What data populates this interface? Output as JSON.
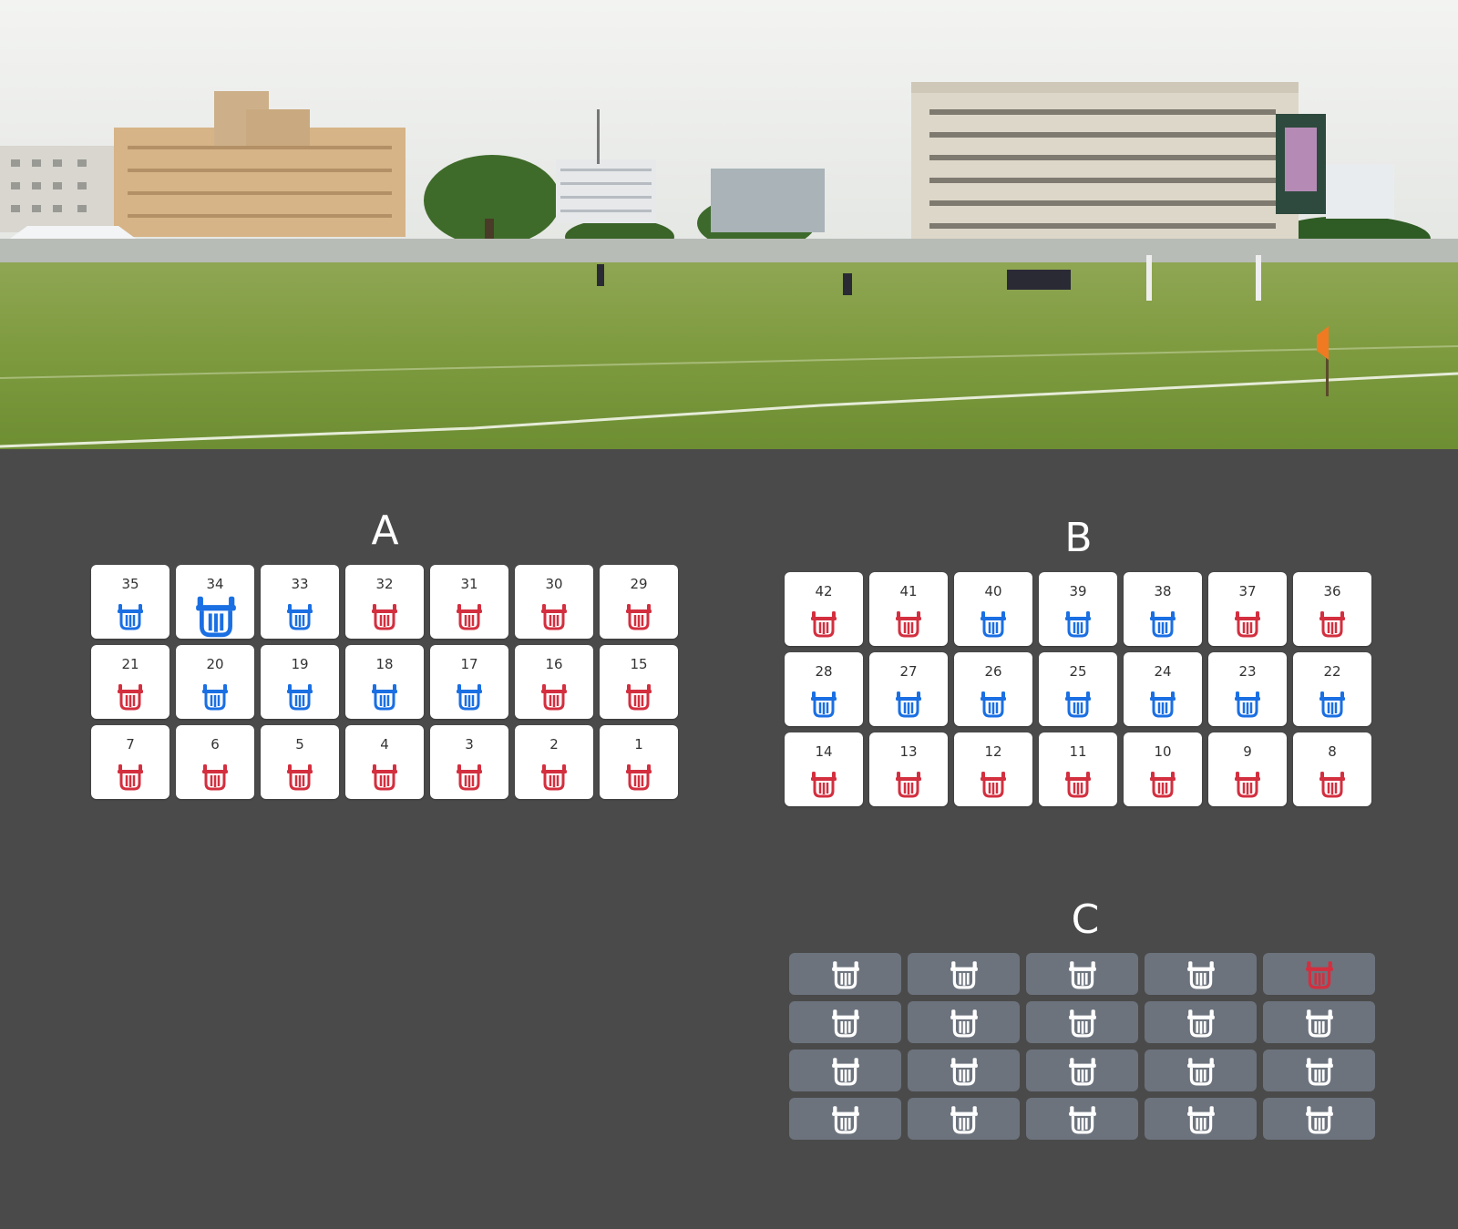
{
  "colors": {
    "available": "#d32f3f",
    "taken": "#1a6fe3",
    "standing_icon": "#ffffff",
    "standing_tile": "#6c737d",
    "background": "#4a4a4a"
  },
  "hero_image": {
    "icon": "stadium-photo"
  },
  "sections": [
    {
      "label": "A",
      "rows": [
        [
          {
            "number": "35",
            "status": "taken"
          },
          {
            "number": "34",
            "status": "taken",
            "selected": true
          },
          {
            "number": "33",
            "status": "taken"
          },
          {
            "number": "32",
            "status": "available"
          },
          {
            "number": "31",
            "status": "available"
          },
          {
            "number": "30",
            "status": "available"
          },
          {
            "number": "29",
            "status": "available"
          }
        ],
        [
          {
            "number": "21",
            "status": "available"
          },
          {
            "number": "20",
            "status": "taken"
          },
          {
            "number": "19",
            "status": "taken"
          },
          {
            "number": "18",
            "status": "taken"
          },
          {
            "number": "17",
            "status": "taken"
          },
          {
            "number": "16",
            "status": "available"
          },
          {
            "number": "15",
            "status": "available"
          }
        ],
        [
          {
            "number": "7",
            "status": "available"
          },
          {
            "number": "6",
            "status": "available"
          },
          {
            "number": "5",
            "status": "available"
          },
          {
            "number": "4",
            "status": "available"
          },
          {
            "number": "3",
            "status": "available"
          },
          {
            "number": "2",
            "status": "available"
          },
          {
            "number": "1",
            "status": "available"
          }
        ]
      ]
    },
    {
      "label": "B",
      "rows": [
        [
          {
            "number": "42",
            "status": "available"
          },
          {
            "number": "41",
            "status": "available"
          },
          {
            "number": "40",
            "status": "taken"
          },
          {
            "number": "39",
            "status": "taken"
          },
          {
            "number": "38",
            "status": "taken"
          },
          {
            "number": "37",
            "status": "available"
          },
          {
            "number": "36",
            "status": "available"
          }
        ],
        [
          {
            "number": "28",
            "status": "taken"
          },
          {
            "number": "27",
            "status": "taken"
          },
          {
            "number": "26",
            "status": "taken"
          },
          {
            "number": "25",
            "status": "taken"
          },
          {
            "number": "24",
            "status": "taken"
          },
          {
            "number": "23",
            "status": "taken"
          },
          {
            "number": "22",
            "status": "taken"
          }
        ],
        [
          {
            "number": "14",
            "status": "available"
          },
          {
            "number": "13",
            "status": "available"
          },
          {
            "number": "12",
            "status": "available"
          },
          {
            "number": "11",
            "status": "available"
          },
          {
            "number": "10",
            "status": "available"
          },
          {
            "number": "9",
            "status": "available"
          },
          {
            "number": "8",
            "status": "available"
          }
        ]
      ]
    },
    {
      "label": "C",
      "standing": true,
      "rows": [
        [
          {
            "status": "open"
          },
          {
            "status": "open"
          },
          {
            "status": "open"
          },
          {
            "status": "open"
          },
          {
            "status": "highlighted"
          }
        ],
        [
          {
            "status": "open"
          },
          {
            "status": "open"
          },
          {
            "status": "open"
          },
          {
            "status": "open"
          },
          {
            "status": "open"
          }
        ],
        [
          {
            "status": "open"
          },
          {
            "status": "open"
          },
          {
            "status": "open"
          },
          {
            "status": "open"
          },
          {
            "status": "open"
          }
        ],
        [
          {
            "status": "open"
          },
          {
            "status": "open"
          },
          {
            "status": "open"
          },
          {
            "status": "open"
          },
          {
            "status": "open"
          }
        ]
      ]
    }
  ]
}
